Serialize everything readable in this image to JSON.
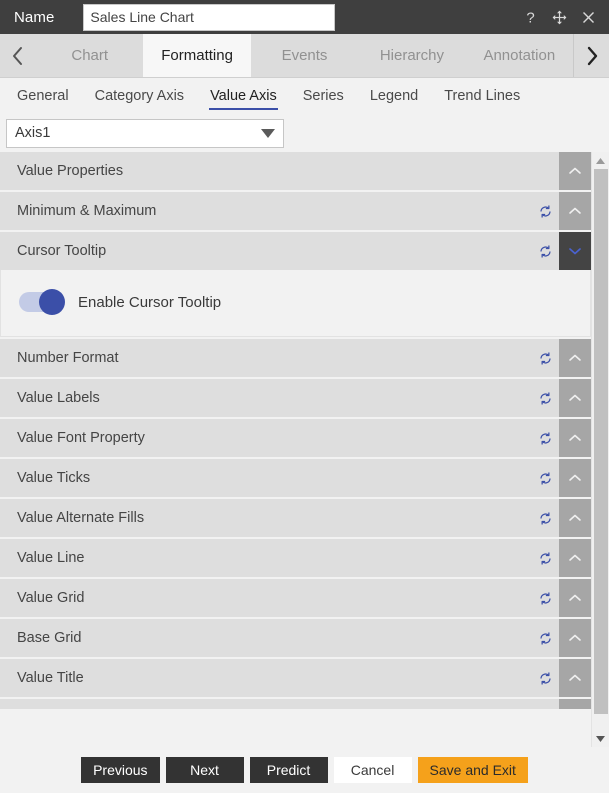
{
  "titlebar": {
    "name_label": "Name",
    "name_value": "Sales Line Chart",
    "name_placeholder": "Name",
    "help_icon": "question-mark-icon",
    "move_icon": "move-arrows-icon",
    "close_icon": "close-icon"
  },
  "main_tabs": {
    "prev_arrow": "chevron-left-icon",
    "next_arrow": "chevron-right-icon",
    "items": [
      {
        "label": "Chart",
        "active": false
      },
      {
        "label": "Formatting",
        "active": true
      },
      {
        "label": "Events",
        "active": false
      },
      {
        "label": "Hierarchy",
        "active": false
      },
      {
        "label": "Annotation",
        "active": false
      }
    ]
  },
  "sub_tabs": {
    "items": [
      {
        "label": "General",
        "active": false
      },
      {
        "label": "Category Axis",
        "active": false
      },
      {
        "label": "Value Axis",
        "active": true
      },
      {
        "label": "Series",
        "active": false
      },
      {
        "label": "Legend",
        "active": false
      },
      {
        "label": "Trend Lines",
        "active": false
      }
    ]
  },
  "axis_selector": {
    "value": "Axis1",
    "caret_icon": "caret-down-icon"
  },
  "accordion": {
    "reset_icon": "reset-refresh-icon",
    "collapse_icon": "chevron-up-icon",
    "expand_icon": "chevron-down-icon",
    "sections": [
      {
        "title": "Value Properties",
        "expanded": false,
        "has_reset": false
      },
      {
        "title": "Minimum & Maximum",
        "expanded": false,
        "has_reset": true
      },
      {
        "title": "Cursor Tooltip",
        "expanded": true,
        "has_reset": true
      },
      {
        "title": "Number Format",
        "expanded": false,
        "has_reset": true
      },
      {
        "title": "Value Labels",
        "expanded": false,
        "has_reset": true
      },
      {
        "title": "Value Font Property",
        "expanded": false,
        "has_reset": true
      },
      {
        "title": "Value Ticks",
        "expanded": false,
        "has_reset": true
      },
      {
        "title": "Value Alternate Fills",
        "expanded": false,
        "has_reset": true
      },
      {
        "title": "Value Line",
        "expanded": false,
        "has_reset": true
      },
      {
        "title": "Value Grid",
        "expanded": false,
        "has_reset": true
      },
      {
        "title": "Base Grid",
        "expanded": false,
        "has_reset": true
      },
      {
        "title": "Value Title",
        "expanded": false,
        "has_reset": true
      }
    ],
    "cursor_tooltip": {
      "toggle_label": "Enable Cursor Tooltip",
      "toggle_on": true
    }
  },
  "scrollbar": {
    "up_arrow": "scroll-up-arrow-icon",
    "down_arrow": "scroll-down-arrow-icon"
  },
  "footer": {
    "previous": "Previous",
    "next": "Next",
    "predict": "Predict",
    "cancel": "Cancel",
    "save_and_exit": "Save and Exit"
  },
  "colors": {
    "titlebar_bg": "#3f3f3f",
    "accent_orange": "#f5a11b",
    "accent_blue": "#3b4fa8",
    "header_row_bg": "#dedede",
    "chevron_btn_bg": "#a6a6a6",
    "chevron_btn_expanded_bg": "#444444"
  }
}
